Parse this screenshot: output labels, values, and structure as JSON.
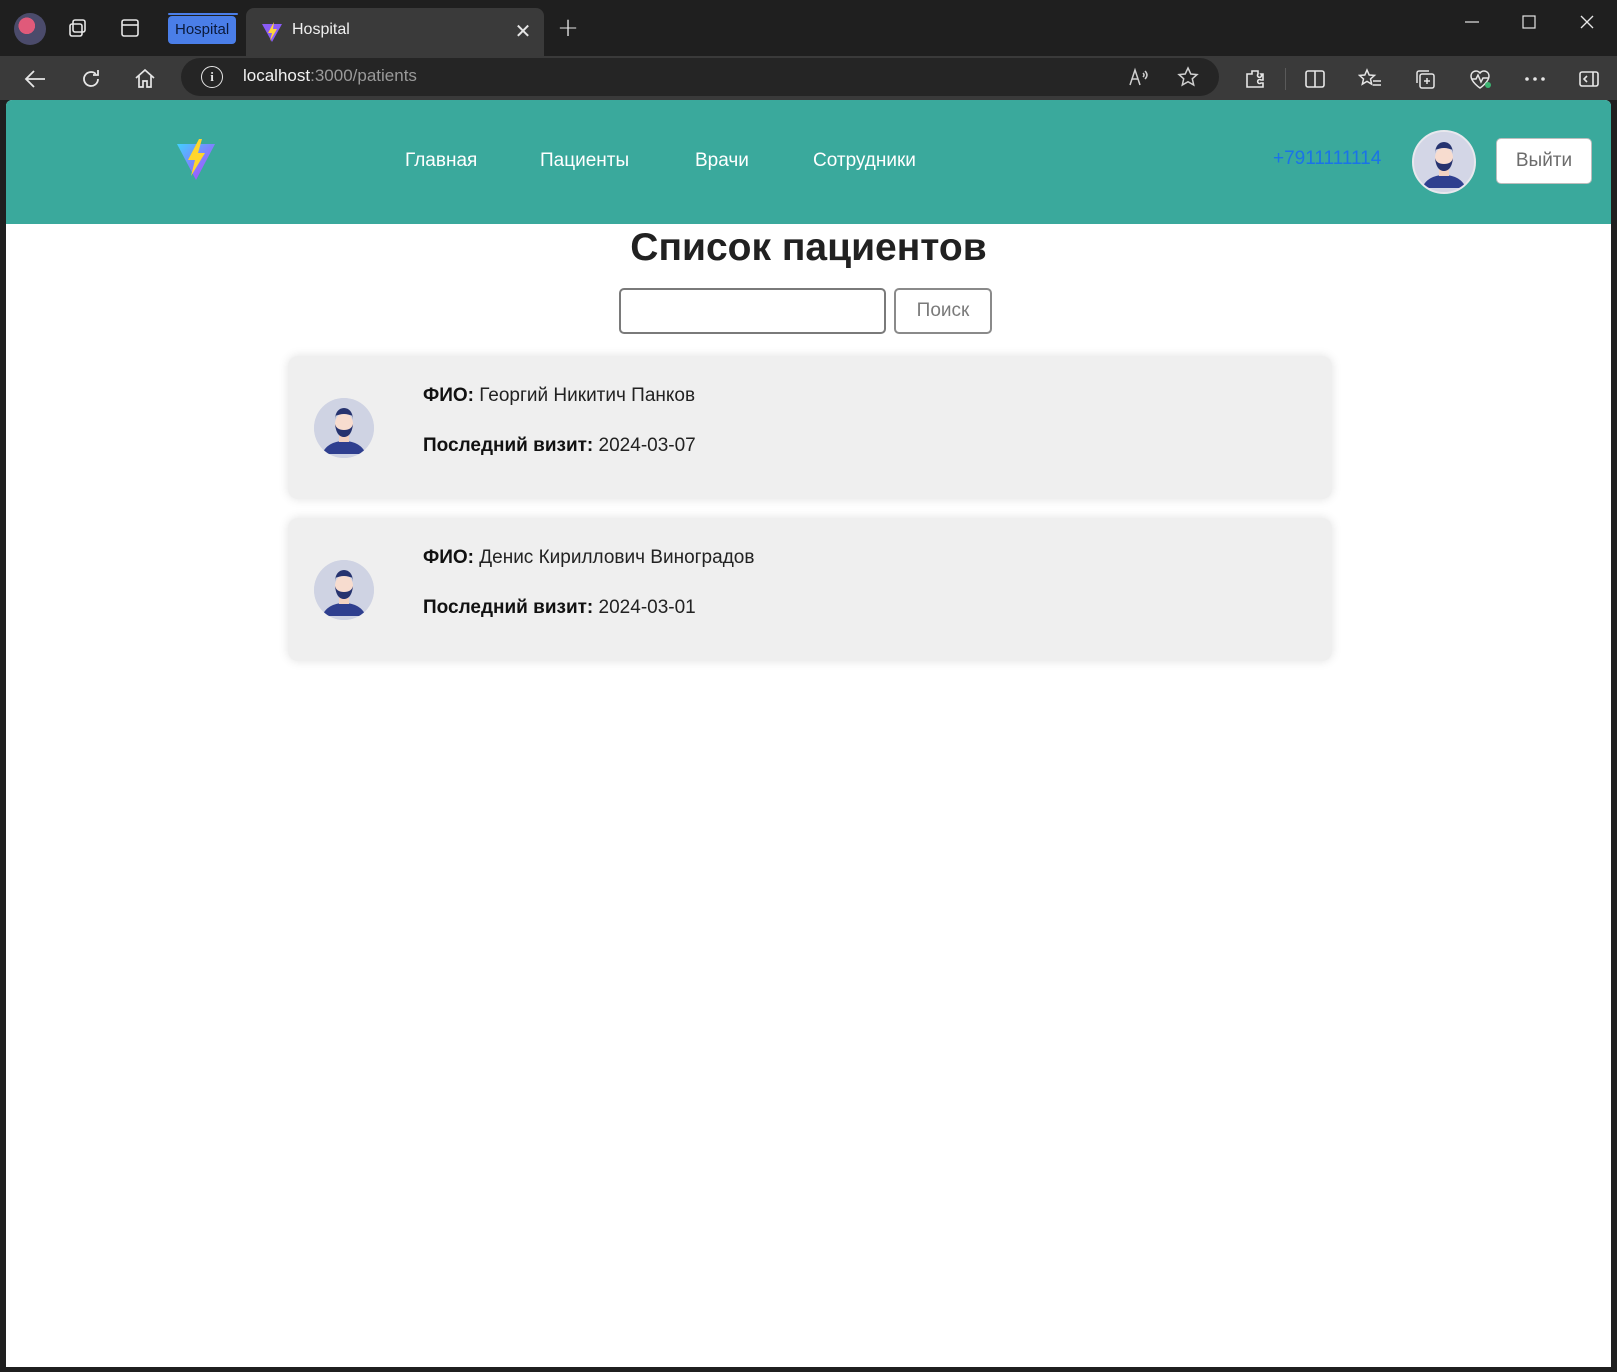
{
  "browser": {
    "tab_group_label": "Hospital",
    "tab_title": "Hospital",
    "url_host": "localhost",
    "url_rest": ":3000/patients"
  },
  "header": {
    "nav": [
      "Главная",
      "Пациенты",
      "Врачи",
      "Сотрудники"
    ],
    "phone": "+7911111114",
    "logout_label": "Выйти",
    "brand_color": "#3aa99c"
  },
  "main": {
    "title": "Список пациентов",
    "search": {
      "value": "",
      "button_label": "Поиск"
    },
    "name_label": "ФИО:",
    "visit_label": "Последний визит:",
    "patients": [
      {
        "name": "Георгий Никитич Панков",
        "last_visit": "2024-03-07"
      },
      {
        "name": "Денис Кириллович Виноградов",
        "last_visit": "2024-03-01"
      }
    ]
  }
}
